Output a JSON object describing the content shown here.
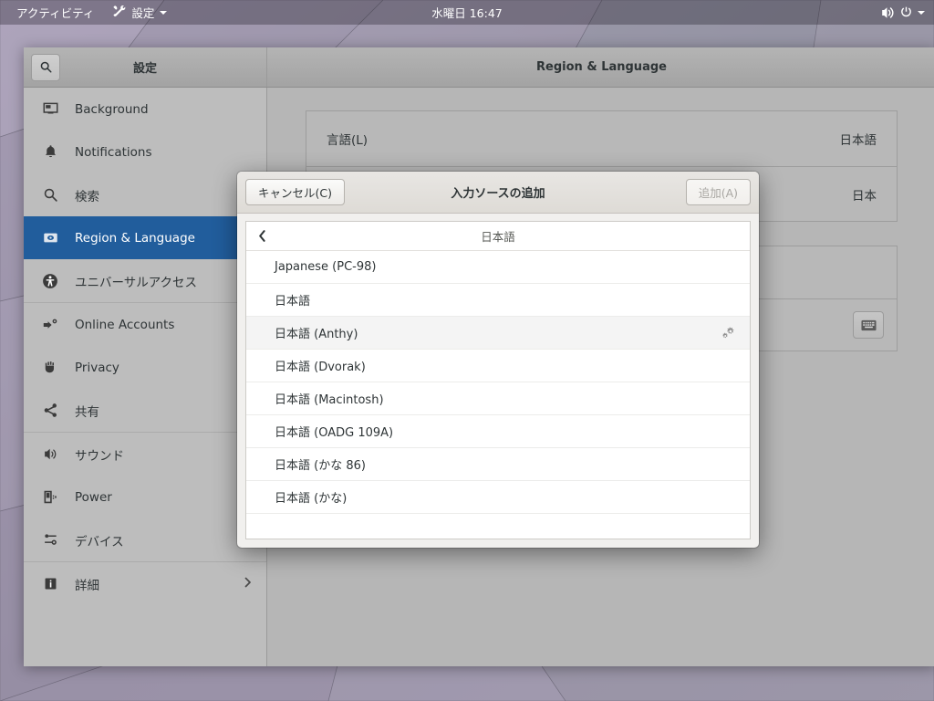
{
  "topbar": {
    "activities": "アクティビティ",
    "app_menu": "設定",
    "app_menu_icon": "settings-tools-icon",
    "clock": "水曜日 16:47",
    "volume_icon": "volume-icon",
    "power_icon": "power-icon",
    "menu_caret_icon": "chevron-down-icon"
  },
  "window": {
    "sidebar_title": "設定",
    "search_icon": "search-icon",
    "content_title": "Region & Language"
  },
  "sidebar": {
    "items": [
      {
        "label": "Background",
        "icon": "monitor-icon",
        "selected": false
      },
      {
        "label": "Notifications",
        "icon": "bell-icon",
        "selected": false
      },
      {
        "label": "検索",
        "icon": "search-icon",
        "selected": false
      },
      {
        "label": "Region & Language",
        "icon": "globe-flag-icon",
        "selected": true
      },
      {
        "label": "ユニバーサルアクセス",
        "icon": "accessibility-icon",
        "selected": false
      },
      {
        "label": "Online Accounts",
        "icon": "online-accounts-icon",
        "selected": false
      },
      {
        "label": "Privacy",
        "icon": "hand-icon",
        "selected": false
      },
      {
        "label": "共有",
        "icon": "share-icon",
        "selected": false
      },
      {
        "label": "サウンド",
        "icon": "speaker-icon",
        "selected": false
      },
      {
        "label": "Power",
        "icon": "battery-plug-icon",
        "selected": false
      },
      {
        "label": "デバイス",
        "icon": "devices-icon",
        "selected": false
      },
      {
        "label": "詳細",
        "icon": "info-icon",
        "selected": false,
        "chevron": "chevron-right-icon"
      }
    ]
  },
  "content": {
    "group1": [
      {
        "label": "言語(L)",
        "value": "日本語"
      },
      {
        "label": "",
        "value": "日本"
      }
    ],
    "keyboard_icon": "keyboard-icon"
  },
  "dialog": {
    "cancel_label": "キャンセル(C)",
    "title": "入力ソースの追加",
    "add_label": "追加(A)",
    "back_icon": "chevron-left-icon",
    "back_label": "日本語",
    "gear_icon": "preferences-gear-icon",
    "items": [
      {
        "label": "Japanese (PC-98)",
        "active": false,
        "gear": false
      },
      {
        "label": "日本語",
        "active": false,
        "gear": false
      },
      {
        "label": "日本語 (Anthy)",
        "active": true,
        "gear": true
      },
      {
        "label": "日本語 (Dvorak)",
        "active": false,
        "gear": false
      },
      {
        "label": "日本語 (Macintosh)",
        "active": false,
        "gear": false
      },
      {
        "label": "日本語 (OADG 109A)",
        "active": false,
        "gear": false
      },
      {
        "label": "日本語 (かな 86)",
        "active": false,
        "gear": false
      },
      {
        "label": "日本語 (かな)",
        "active": false,
        "gear": false
      }
    ]
  },
  "colors": {
    "selection_blue": "#215d9c",
    "window_chrome": "#b6b6b6",
    "dialog_bg": "#f1f0ee"
  }
}
